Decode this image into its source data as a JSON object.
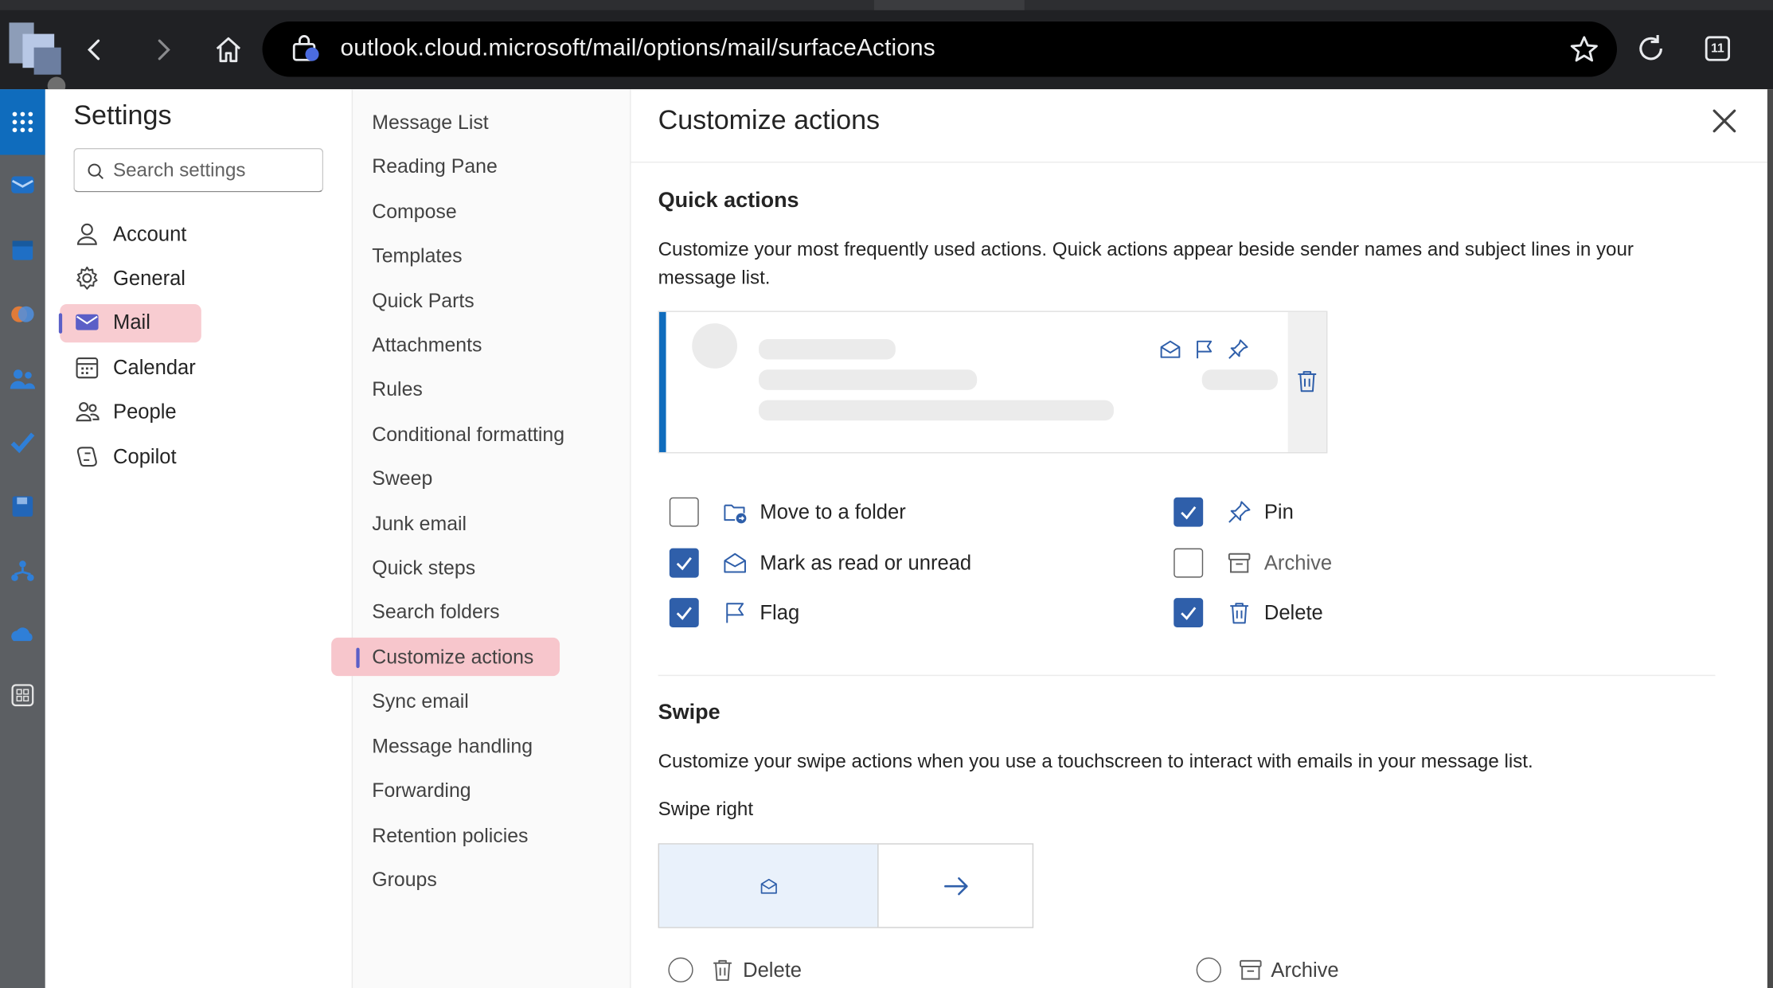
{
  "browser": {
    "url": "outlook.cloud.microsoft/mail/options/mail/surfaceActions",
    "tab_count": "11"
  },
  "settings": {
    "title": "Settings",
    "search_placeholder": "Search settings",
    "categories": [
      {
        "label": "Account",
        "icon": "person-icon"
      },
      {
        "label": "General",
        "icon": "gear-icon"
      },
      {
        "label": "Mail",
        "icon": "mail-icon"
      },
      {
        "label": "Calendar",
        "icon": "calendar-icon"
      },
      {
        "label": "People",
        "icon": "people-icon"
      },
      {
        "label": "Copilot",
        "icon": "copilot-icon"
      }
    ],
    "subcategories": [
      "Message List",
      "Reading Pane",
      "Compose",
      "Templates",
      "Quick Parts",
      "Attachments",
      "Rules",
      "Conditional formatting",
      "Sweep",
      "Junk email",
      "Quick steps",
      "Search folders",
      "Customize actions",
      "Sync email",
      "Message handling",
      "Forwarding",
      "Retention policies",
      "Groups"
    ]
  },
  "panel": {
    "title": "Customize actions",
    "quick": {
      "title": "Quick actions",
      "desc_line1": "Customize your most frequently used actions. Quick actions appear beside sender names and subject lines in your",
      "desc_line2": "message list.",
      "options": [
        {
          "label": "Move to a folder",
          "checked": false,
          "icon": "folder-move-icon"
        },
        {
          "label": "Mark as read or unread",
          "checked": true,
          "icon": "mail-open-icon"
        },
        {
          "label": "Flag",
          "checked": true,
          "icon": "flag-icon"
        },
        {
          "label": "Pin",
          "checked": true,
          "icon": "pin-icon"
        },
        {
          "label": "Archive",
          "checked": false,
          "icon": "archive-icon"
        },
        {
          "label": "Delete",
          "checked": true,
          "icon": "trash-icon"
        }
      ]
    },
    "swipe": {
      "title": "Swipe",
      "desc": "Customize your swipe actions when you use a touchscreen to interact with emails in your message list.",
      "right_label": "Swipe right",
      "radio_options": [
        {
          "label": "Delete",
          "icon": "trash-icon"
        },
        {
          "label": "Archive",
          "icon": "archive-icon"
        }
      ]
    }
  },
  "colors": {
    "accent": "#0f6cbd",
    "checkbox": "#2f5faa",
    "highlight": "#f7c6cc",
    "rail": "#5c5f63"
  }
}
